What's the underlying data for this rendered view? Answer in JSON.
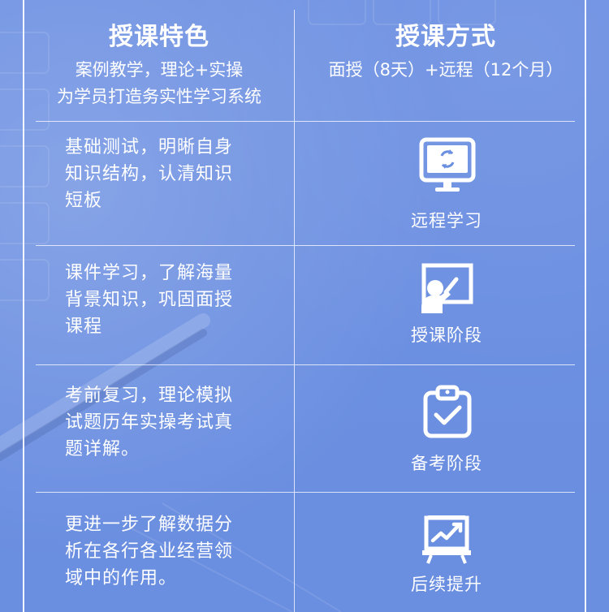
{
  "header": {
    "left_title": "授课特色",
    "left_sub_1": "案例教学，理论+实操",
    "left_sub_2": "为学员打造务实性学习系统",
    "right_title": "授课方式",
    "right_sub": "面授（8天）+远程（12个月）"
  },
  "rows": [
    {
      "text": "基础测试，明晰自身\n知识结构，认清知识\n短板",
      "icon": "monitor-sync-icon",
      "label": "远程学习"
    },
    {
      "text": "课件学习，了解海量\n背景知识，巩固面授\n课程",
      "icon": "teacher-board-icon",
      "label": "授课阶段"
    },
    {
      "text": "考前复习，理论模拟\n试题历年实操考试真\n题详解。",
      "icon": "clipboard-check-icon",
      "label": "备考阶段"
    },
    {
      "text": "更进一步了解数据分\n析在各行各业经营领\n域中的作用。",
      "icon": "growth-chart-board-icon",
      "label": "后续提升"
    }
  ],
  "colors": {
    "background": "#6b8fe0",
    "text": "#ffffff",
    "lines": "#ffffff"
  }
}
